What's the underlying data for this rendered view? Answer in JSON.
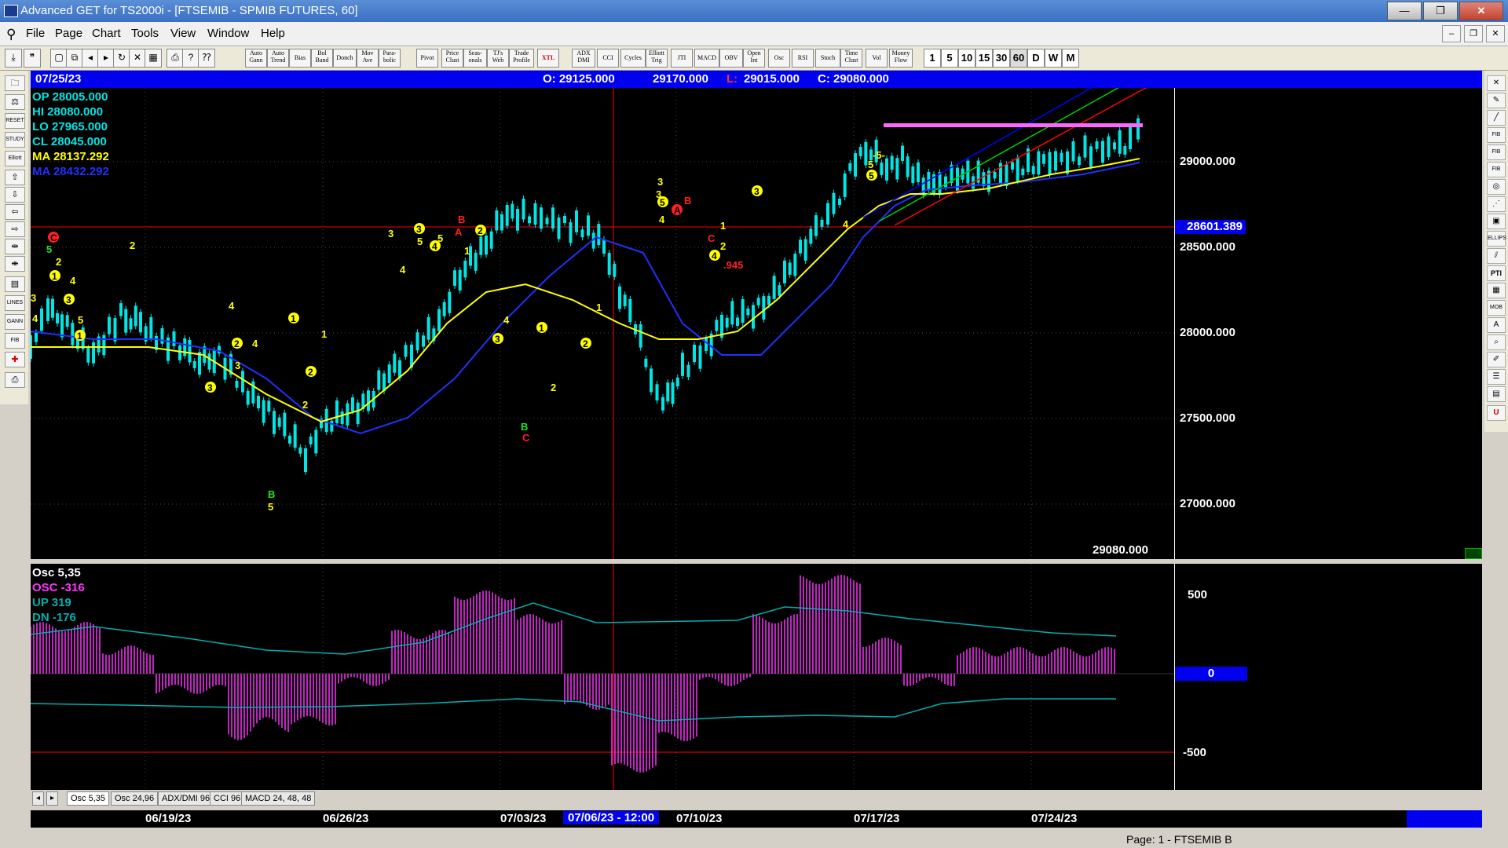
{
  "window": {
    "title": "Advanced GET for TS2000i - [FTSEMIB - SPMIB FUTURES, 60]",
    "minimize": "—",
    "maximize": "❐",
    "close": "✕"
  },
  "menu": [
    "File",
    "Page",
    "Chart",
    "Tools",
    "View",
    "Window",
    "Help"
  ],
  "toolbar": {
    "studies": [
      "Auto Gann",
      "Auto Trend",
      "Bias",
      "Bol Band",
      "Donch",
      "Mov Ave",
      "Para- bolic",
      "Pivot",
      "Price Clust",
      "Seas- onals",
      "TJ's Web",
      "Trade Profile",
      "XTL",
      "ADX DMI",
      "CCI",
      "Cycles",
      "Elliott Trig",
      "JTI",
      "MACD",
      "OBV",
      "Open Int",
      "Osc",
      "RSI",
      "Stoch",
      "Time Clust",
      "Vol",
      "Money Flow"
    ],
    "timeframes": [
      "1",
      "5",
      "10",
      "15",
      "30",
      "60",
      "D",
      "W",
      "M"
    ]
  },
  "infobar": {
    "date": "07/25/23",
    "open": "O: 29125.000",
    "high": "29170.000",
    "low_label": "L:",
    "low": "29015.000",
    "close": "C: 29080.000"
  },
  "readout": [
    {
      "label": "OP",
      "value": "28005.000",
      "color": "#00e5e5"
    },
    {
      "label": "HI",
      "value": "28080.000",
      "color": "#00e5e5"
    },
    {
      "label": "LO",
      "value": "27965.000",
      "color": "#00e5e5"
    },
    {
      "label": "CL",
      "value": "28045.000",
      "color": "#00e5e5"
    },
    {
      "label": "MA",
      "value": "28137.292",
      "color": "#ffff00"
    },
    {
      "label": "MA",
      "value": "28432.292",
      "color": "#2030ff"
    }
  ],
  "price_axis": {
    "ticks": [
      "29000.000",
      "28500.000",
      "28000.000",
      "27500.000",
      "27000.000"
    ],
    "marker": "28601.389",
    "last": "29080.000"
  },
  "osc_readout": [
    {
      "label": "Osc 5,35",
      "color": "#ffffff"
    },
    {
      "label": "OSC -316",
      "color": "#ff33ff"
    },
    {
      "label": "UP  319",
      "color": "#00b0b0"
    },
    {
      "label": "DN  -176",
      "color": "#00b0b0"
    }
  ],
  "osc_axis": [
    "500",
    "0",
    "-500"
  ],
  "tabs": [
    "Osc 5,35",
    "Osc 24,96",
    "ADX/DMI 96",
    "CCI 96",
    "MACD 24, 48, 48"
  ],
  "dates": [
    "06/19/23",
    "06/26/23",
    "07/03/23",
    "07/06/23 - 12:00",
    "07/10/23",
    "07/17/23",
    "07/24/23"
  ],
  "status": "Page: 1 - FTSEMIB B",
  "elliott_labels": [
    {
      "t": "C",
      "color": "red"
    },
    {
      "t": "5",
      "color": "green"
    },
    {
      "t": "2",
      "color": "yellow"
    },
    {
      "t": "1",
      "color": "yellow"
    },
    {
      "t": "4",
      "color": "yellow"
    },
    {
      "t": "3",
      "color": "yellow"
    },
    {
      "t": "3",
      "color": "yellow"
    },
    {
      "t": "4",
      "color": "yellow"
    },
    {
      "t": "5",
      "color": "yellow"
    },
    {
      "t": "1",
      "color": "yellow"
    },
    {
      "t": "2",
      "color": "yellow"
    },
    {
      "t": "4",
      "color": "yellow"
    },
    {
      "t": "2",
      "color": "yellow"
    },
    {
      "t": "4",
      "color": "yellow"
    },
    {
      "t": "3",
      "color": "yellow"
    },
    {
      "t": "3",
      "color": "yellow"
    },
    {
      "t": "B",
      "color": "green"
    },
    {
      "t": "5",
      "color": "yellow"
    },
    {
      "t": "1",
      "color": "yellow"
    },
    {
      "t": "2",
      "color": "yellow"
    },
    {
      "t": "1",
      "color": "yellow"
    },
    {
      "t": "2",
      "color": "yellow"
    },
    {
      "t": "3",
      "color": "yellow"
    },
    {
      "t": "4",
      "color": "yellow"
    },
    {
      "t": "3",
      "color": "yellow"
    },
    {
      "t": "5",
      "color": "yellow"
    },
    {
      "t": "5",
      "color": "yellow"
    },
    {
      "t": "4",
      "color": "yellow"
    },
    {
      "t": "B",
      "color": "red"
    },
    {
      "t": "A",
      "color": "red"
    },
    {
      "t": "2",
      "color": "yellow"
    },
    {
      "t": "1",
      "color": "yellow"
    },
    {
      "t": "4",
      "color": "yellow"
    },
    {
      "t": "3",
      "color": "yellow"
    },
    {
      "t": "B",
      "color": "green"
    },
    {
      "t": "C",
      "color": "red"
    },
    {
      "t": "1",
      "color": "yellow"
    },
    {
      "t": "2",
      "color": "yellow"
    },
    {
      "t": "1",
      "color": "yellow"
    },
    {
      "t": "2",
      "color": "yellow"
    },
    {
      "t": "3",
      "color": "yellow"
    },
    {
      "t": "3",
      "color": "yellow"
    },
    {
      "t": "5",
      "color": "yellow"
    },
    {
      "t": "4",
      "color": "yellow"
    },
    {
      "t": "B",
      "color": "red"
    },
    {
      "t": "A",
      "color": "red"
    },
    {
      "t": "C",
      "color": "red"
    },
    {
      "t": "2",
      "color": "yellow"
    },
    {
      "t": "4",
      "color": "yellow"
    },
    {
      "t": ".945",
      "color": "red"
    },
    {
      "t": "1",
      "color": "yellow"
    },
    {
      "t": "3",
      "color": "yellow"
    },
    {
      "t": "4",
      "color": "yellow"
    },
    {
      "t": "5",
      "color": "yellow"
    },
    {
      "t": "5",
      "color": "yellow"
    },
    {
      "t": "-5-",
      "color": "yellow"
    }
  ],
  "colors": {
    "price_bars": "#00e5e5",
    "ma_fast": "#ffff00",
    "ma_slow": "#2030ff",
    "oscillator": "#ff33ff",
    "bands": "#00b0b0",
    "axis_blue": "#0000ee",
    "trend_red": "#ff0000",
    "trend_green": "#00cc00",
    "trend_blue": "#0000ff"
  }
}
